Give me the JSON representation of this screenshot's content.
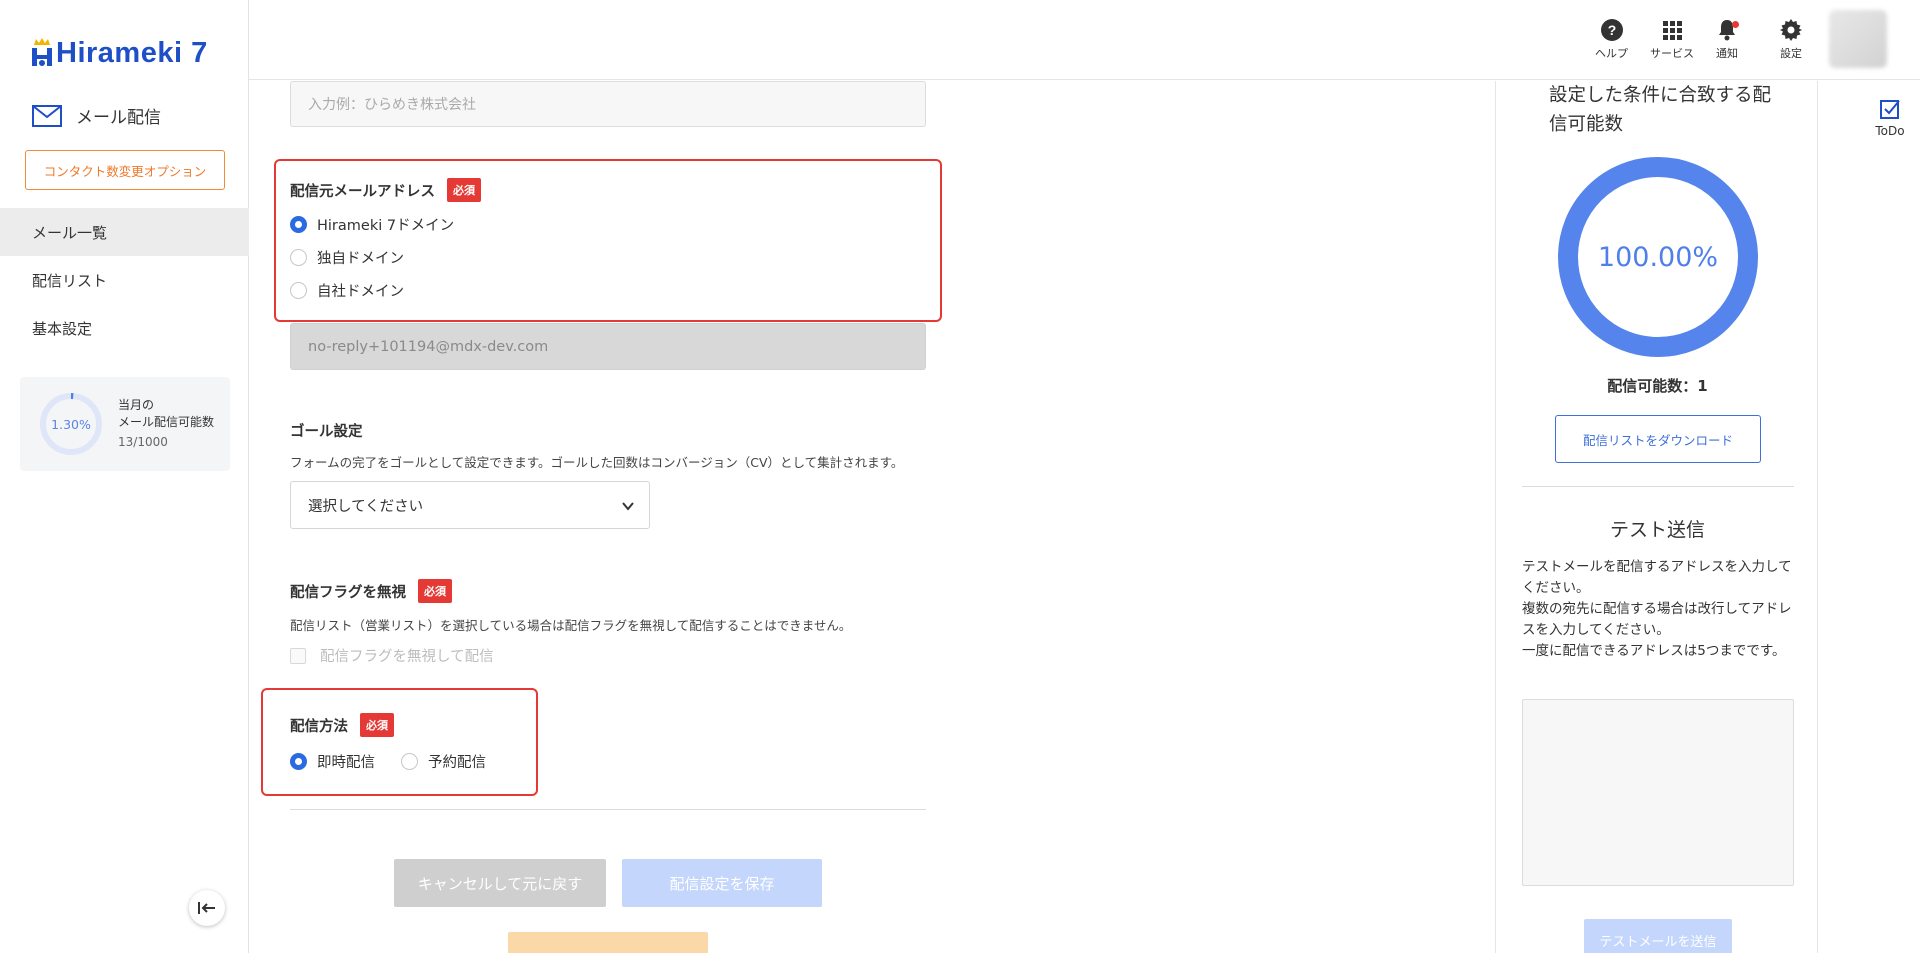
{
  "brand": {
    "name": "Hirameki 7",
    "primary": "#1e4fc7",
    "accent": "#2b6be2",
    "danger": "#e53935"
  },
  "sidebar": {
    "section_title": "メール配信",
    "contact_option_label": "コンタクト数変更オプション",
    "nav": [
      {
        "label": "メール一覧",
        "active": true
      },
      {
        "label": "配信リスト",
        "active": false
      },
      {
        "label": "基本設定",
        "active": false
      }
    ],
    "quota": {
      "percent_label": "1.30%",
      "percent": 1.3,
      "label_line1": "当月の",
      "label_line2": "メール配信可能数",
      "count": "13/1000"
    }
  },
  "header": {
    "help": "ヘルプ",
    "services": "サービス",
    "notifications": "通知",
    "settings": "設定"
  },
  "form": {
    "company_placeholder": "入力例：ひらめき株式会社",
    "sender_address": {
      "title": "配信元メールアドレス",
      "required": "必須",
      "options": [
        {
          "label": "Hirameki 7ドメイン",
          "selected": true
        },
        {
          "label": "独自ドメイン",
          "selected": false
        },
        {
          "label": "自社ドメイン",
          "selected": false
        }
      ],
      "value": "no-reply+101194@mdx-dev.com"
    },
    "goal": {
      "title": "ゴール設定",
      "description": "フォームの完了をゴールとして設定できます。ゴールした回数はコンバージョン（CV）として集計されます。",
      "select_value": "選択してください"
    },
    "ignore_flag": {
      "title": "配信フラグを無視",
      "required": "必須",
      "description": "配信リスト（営業リスト）を選択している場合は配信フラグを無視して配信することはできません。",
      "checkbox_label": "配信フラグを無視して配信"
    },
    "delivery_method": {
      "title": "配信方法",
      "required": "必須",
      "options": [
        {
          "label": "即時配信",
          "selected": true
        },
        {
          "label": "予約配信",
          "selected": false
        }
      ]
    },
    "buttons": {
      "cancel": "キャンセルして元に戻す",
      "save": "配信設定を保存"
    }
  },
  "right_panel": {
    "title": "設定した条件に合致する配信可能数",
    "donut_label": "100.00%",
    "donut_percent": 100,
    "count_label": "配信可能数：1",
    "download_label": "配信リストをダウンロード",
    "test_title": "テスト送信",
    "test_desc_1": "テストメールを配信するアドレスを入力してください。",
    "test_desc_2": "複数の宛先に配信する場合は改行してアドレスを入力してください。",
    "test_desc_3": "一度に配信できるアドレスは5つまでです。",
    "send_label": "テストメールを送信"
  },
  "todo": {
    "label": "ToDo"
  }
}
